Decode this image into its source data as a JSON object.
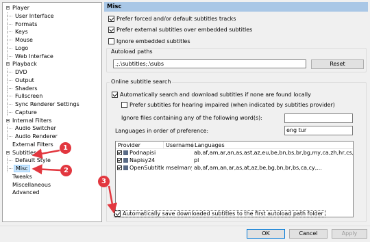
{
  "tree": {
    "items": [
      {
        "label": "Player",
        "level": 0,
        "expander": true
      },
      {
        "label": "User Interface",
        "level": 1
      },
      {
        "label": "Formats",
        "level": 1
      },
      {
        "label": "Keys",
        "level": 1
      },
      {
        "label": "Mouse",
        "level": 1
      },
      {
        "label": "Logo",
        "level": 1
      },
      {
        "label": "Web Interface",
        "level": 1
      },
      {
        "label": "Playback",
        "level": 0,
        "expander": true
      },
      {
        "label": "DVD",
        "level": 1
      },
      {
        "label": "Output",
        "level": 1
      },
      {
        "label": "Shaders",
        "level": 1
      },
      {
        "label": "Fullscreen",
        "level": 1
      },
      {
        "label": "Sync Renderer Settings",
        "level": 1
      },
      {
        "label": "Capture",
        "level": 1
      },
      {
        "label": "Internal Filters",
        "level": 0,
        "expander": true
      },
      {
        "label": "Audio Switcher",
        "level": 1
      },
      {
        "label": "Audio Renderer",
        "level": 1
      },
      {
        "label": "External Filters",
        "level": 0
      },
      {
        "label": "Subtitles",
        "level": 0,
        "expander": true
      },
      {
        "label": "Default Style",
        "level": 1
      },
      {
        "label": "Misc",
        "level": 1,
        "selected": true
      },
      {
        "label": "Tweaks",
        "level": 0
      },
      {
        "label": "Miscellaneous",
        "level": 0
      },
      {
        "label": "Advanced",
        "level": 0
      }
    ]
  },
  "page": {
    "title": "Misc"
  },
  "options": {
    "forced": "Prefer forced and/or default subtitles tracks",
    "external": "Prefer external subtitles over embedded subtitles",
    "ignore_embedded": "Ignore embedded subtitles"
  },
  "autoload": {
    "title": "Autoload paths",
    "value": ".;.\\subtitles;.\\subs",
    "reset_label": "Reset"
  },
  "online": {
    "title": "Online subtitle search",
    "auto_search": "Automatically search and download subtitles if none are found locally",
    "hearing_impaired": "Prefer subtitles for hearing impaired (when indicated by subtitles provider)",
    "ignore_files_label": "Ignore files containing any of the following word(s):",
    "ignore_files_value": "",
    "languages_label": "Languages in order of preference:",
    "languages_value": "eng tur",
    "columns": [
      "Provider",
      "Username",
      "Languages"
    ],
    "providers": [
      {
        "name": "Podnapisi",
        "username": "",
        "languages": "ab,af,am,ar,an,as,ast,az,eu,be,bn,bs,br,bg,my,ca,zh,hr,cs,da,nl,en,eo,et,fa,fi,fr,ga,..."
      },
      {
        "name": "Napisy24",
        "username": "",
        "languages": "pl"
      },
      {
        "name": "OpenSubtitle...",
        "username": "mselmany",
        "languages": "ab,af,am,an,ar,as,at,az,be,bg,bn,br,bs,ca,cy,..."
      }
    ],
    "auto_save": "Automatically save downloaded subtitles to the first autoload path folder"
  },
  "annotations": [
    "1",
    "2",
    "3"
  ],
  "footer": {
    "ok_label": "OK",
    "cancel_label": "Cancel",
    "apply_label": "Apply"
  },
  "colors": {
    "header": "#a9c7e6",
    "selection": "#cce8ff",
    "annotation": "#e2373f"
  }
}
